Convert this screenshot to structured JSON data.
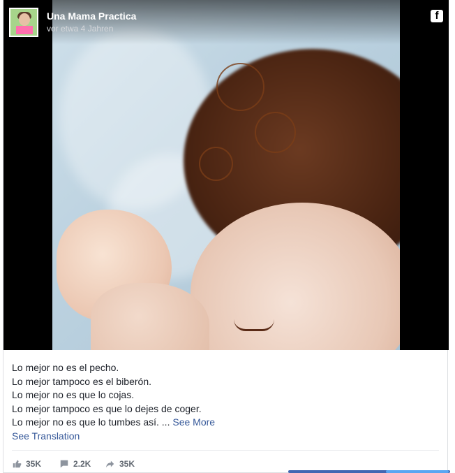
{
  "post": {
    "page_name": "Una Mama Practica",
    "timestamp": "vor etwa 4 Jahren",
    "brand_icon": "facebook-icon",
    "text_lines": [
      "Lo mejor no es el pecho.",
      "Lo mejor tampoco es el biberón.",
      "Lo mejor no es que lo cojas.",
      "Lo mejor tampoco es que lo dejes de coger.",
      "Lo mejor no es que lo tumbes así. ..."
    ],
    "see_more": "See More",
    "see_translation": "See Translation"
  },
  "stats": {
    "likes": "35K",
    "comments": "2.2K",
    "shares": "35K"
  },
  "colors": {
    "link": "#365899",
    "text": "#1d2129",
    "muted": "#606770"
  }
}
